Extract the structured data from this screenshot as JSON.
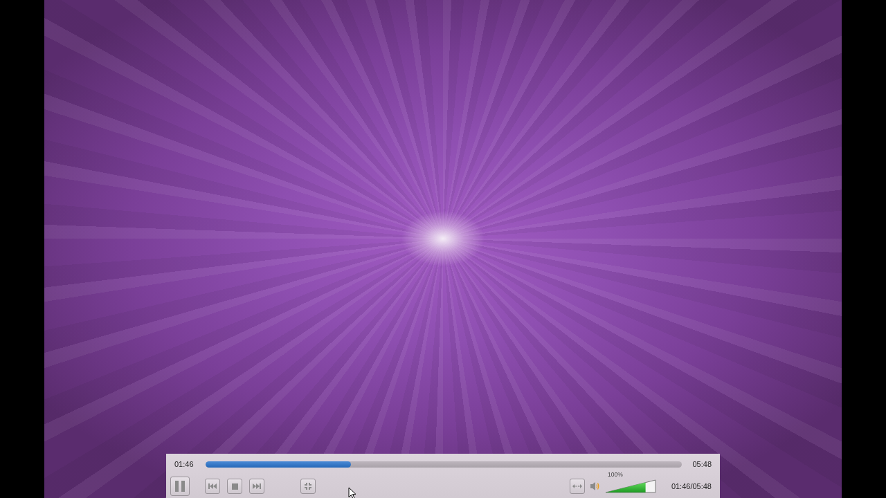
{
  "player": {
    "elapsed": "01:46",
    "total": "05:48",
    "progress": {
      "level": 0.305
    },
    "left_buttons": [
      {
        "kind": "pause"
      },
      {
        "kind": "previous"
      },
      {
        "kind": "stop"
      },
      {
        "kind": "next"
      },
      {
        "kind": "fullscreen-exit"
      }
    ],
    "right_buttons": [
      {
        "kind": "aspect"
      }
    ],
    "volume": {
      "level": 0.8,
      "reading": "100%"
    },
    "time_display": "01:46/05:48"
  }
}
